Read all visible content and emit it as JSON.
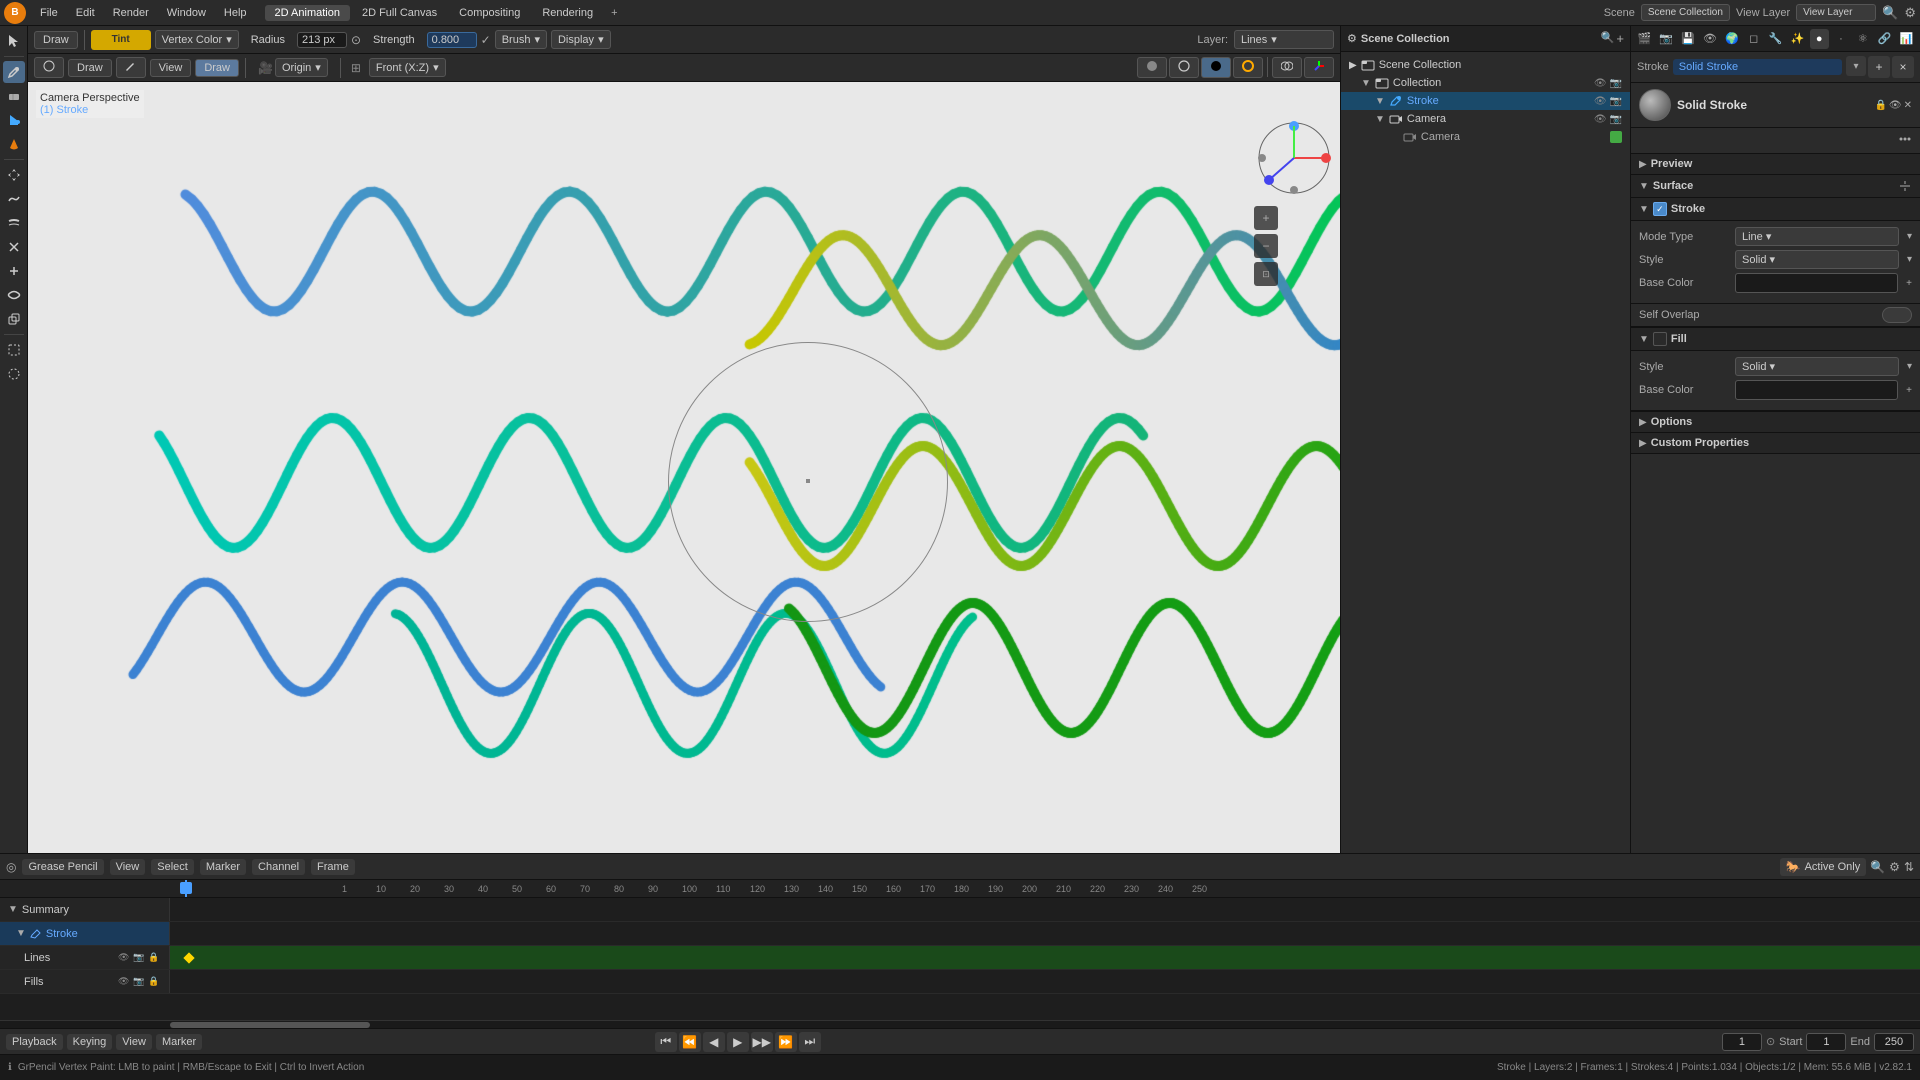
{
  "app": {
    "logo": "B",
    "title": "Blender"
  },
  "menubar": {
    "items": [
      "File",
      "Edit",
      "Render",
      "Window",
      "Help"
    ],
    "active_tab": "2D Animation",
    "tabs": [
      "2D Full Canvas",
      "Compositing",
      "Rendering"
    ],
    "plus": "+"
  },
  "header_toolbar": {
    "mode_dropdown": "Draw",
    "tint_label": "Tint",
    "vertex_color": "Vertex Color",
    "radius_label": "Radius",
    "radius_value": "213 px",
    "strength_label": "Strength",
    "strength_value": "0.800",
    "brush_label": "Brush",
    "display_label": "Display",
    "layer_label": "Layer:",
    "layer_value": "Lines"
  },
  "draw_toolbar2": {
    "mode": "Draw",
    "origin": "Origin",
    "front": "Front (X:Z)",
    "view_btn": "View",
    "draw_btn": "Draw"
  },
  "viewport": {
    "camera_text": "Camera Perspective",
    "stroke_text": "(1) Stroke"
  },
  "left_tools": {
    "tools": [
      "cursor",
      "draw",
      "erase",
      "fill",
      "tint",
      "transform",
      "smooth",
      "thickness",
      "pinch",
      "push",
      "twist",
      "clone",
      "box-select",
      "circle-select"
    ]
  },
  "scene_panel": {
    "title": "Scene Collection",
    "items": [
      {
        "name": "Collection",
        "level": 1,
        "type": "collection"
      },
      {
        "name": "Stroke",
        "level": 2,
        "type": "grease_pencil",
        "active": true
      },
      {
        "name": "Camera",
        "level": 2,
        "type": "camera"
      },
      {
        "name": "Camera",
        "level": 3,
        "type": "camera_obj"
      }
    ]
  },
  "mat_props": {
    "tabs": [
      "scene",
      "render",
      "output",
      "view",
      "world",
      "object",
      "modifier",
      "shader",
      "material",
      "particles",
      "physics",
      "constraints",
      "data",
      "bone"
    ],
    "stroke_label": "Stroke",
    "solid_stroke_label": "Solid Stroke",
    "material_name": "Solid Stroke",
    "add_btn": "+",
    "remove_btn": "×",
    "browse_btn": "▾",
    "stroke_section": {
      "title": "Stroke",
      "checked": true,
      "mode_type_label": "Mode Type",
      "mode_type_value": "Line",
      "style_label": "Style",
      "style_value": "Solid",
      "base_color_label": "Base Color",
      "self_overlap_label": "Self Overlap"
    },
    "fill_section": {
      "title": "Fill",
      "checked": false,
      "style_label": "Style",
      "style_value": "Solid",
      "base_color_label": "Base Color"
    },
    "options_section": {
      "title": "Options"
    },
    "custom_props_section": {
      "title": "Custom Properties"
    }
  },
  "timeline": {
    "header_items": [
      "Grease Pencil",
      "View",
      "Select",
      "Marker",
      "Channel",
      "Frame"
    ],
    "active_only_label": "Active Only",
    "ruler_marks": [
      "1",
      "10",
      "20",
      "30",
      "40",
      "50",
      "60",
      "70",
      "80",
      "90",
      "100",
      "110",
      "120",
      "130",
      "140",
      "150",
      "160",
      "170",
      "180",
      "190",
      "200",
      "210",
      "220",
      "230",
      "240",
      "250"
    ],
    "tracks": [
      {
        "name": "Summary",
        "level": 0,
        "expanded": true
      },
      {
        "name": "Stroke",
        "level": 1,
        "active": true
      },
      {
        "name": "Lines",
        "level": 2,
        "has_keyframe": true
      },
      {
        "name": "Fills",
        "level": 2
      }
    ],
    "playhead_frame": "1"
  },
  "playback": {
    "playback_label": "Playback",
    "keying_label": "Keying",
    "view_label": "View",
    "marker_label": "Marker",
    "transport": {
      "jump_start": "⏮",
      "prev_keyframe": "⏪",
      "prev_frame": "◀",
      "play": "▶",
      "next_frame": "▶",
      "next_keyframe": "⏩",
      "jump_end": "⏭"
    },
    "frame_current": "1",
    "start_label": "Start",
    "start_value": "1",
    "end_label": "End",
    "end_value": "250"
  },
  "status_bar": {
    "text": "GrPencil Vertex Paint: LMB to paint | RMB/Escape to Exit | Ctrl to Invert Action",
    "info": "Stroke | Layers:2 | Frames:1 | Strokes:4 | Points:1.034 | Objects:1/2 | Mem: 55.6 MiB | v2.82.1"
  }
}
